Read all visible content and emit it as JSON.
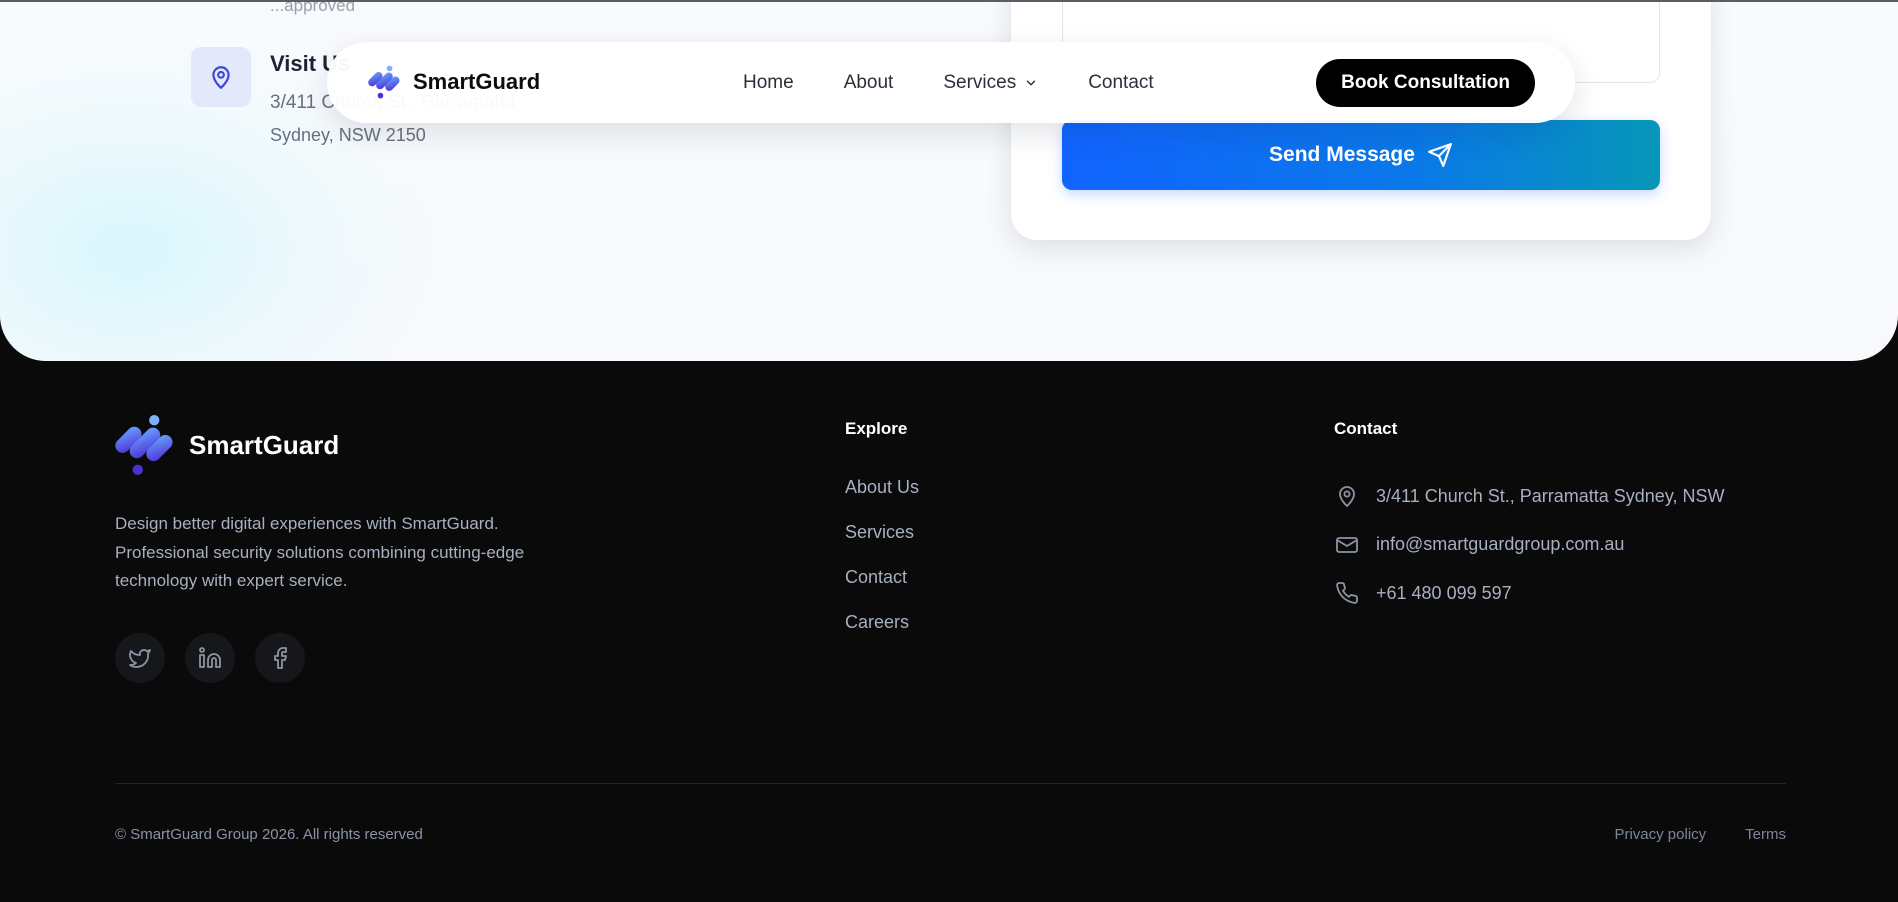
{
  "colors": {
    "accent_blue": "#1264ff",
    "accent_teal": "#0797b8",
    "logo_gradient_start": "#5b8df6",
    "logo_gradient_end": "#4b2fd4",
    "footer_bg": "#0a0a0b"
  },
  "contact_section": {
    "faded_text": "...approved",
    "visit": {
      "icon": "map-pin-icon",
      "title": "Visit Us",
      "line1": "3/411 Church St., Parramatta",
      "line2": "Sydney, NSW 2150"
    },
    "send_button": {
      "label": "Send Message",
      "icon": "send-paper-plane-icon"
    }
  },
  "navbar": {
    "brand": "SmartGuard",
    "links": [
      {
        "label": "Home"
      },
      {
        "label": "About"
      },
      {
        "label": "Services",
        "icon": "chevron-down-icon"
      },
      {
        "label": "Contact"
      }
    ],
    "cta": "Book Consultation"
  },
  "footer": {
    "brand": "SmartGuard",
    "description": "Design better digital experiences with SmartGuard. Professional security solutions combining cutting-edge technology with expert service.",
    "socials": [
      {
        "icon": "twitter-icon"
      },
      {
        "icon": "linkedin-icon"
      },
      {
        "icon": "facebook-icon"
      }
    ],
    "explore": {
      "title": "Explore",
      "items": [
        "About Us",
        "Services",
        "Contact",
        "Careers"
      ]
    },
    "contact": {
      "title": "Contact",
      "items": [
        {
          "icon": "map-pin-icon",
          "text": "3/411 Church St., Parramatta Sydney, NSW"
        },
        {
          "icon": "mail-icon",
          "text": "info@smartguardgroup.com.au"
        },
        {
          "icon": "phone-icon",
          "text": "+61 480 099 597"
        }
      ]
    },
    "copyright": "© SmartGuard Group 2026. All rights reserved",
    "legal": [
      "Privacy policy",
      "Terms"
    ]
  }
}
